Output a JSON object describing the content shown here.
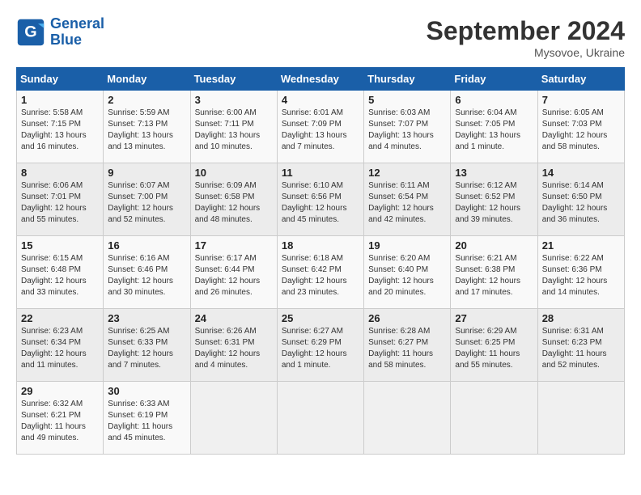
{
  "header": {
    "logo_line1": "General",
    "logo_line2": "Blue",
    "month": "September 2024",
    "location": "Mysovoe, Ukraine"
  },
  "days_of_week": [
    "Sunday",
    "Monday",
    "Tuesday",
    "Wednesday",
    "Thursday",
    "Friday",
    "Saturday"
  ],
  "weeks": [
    [
      {
        "day": "1",
        "sunrise": "Sunrise: 5:58 AM",
        "sunset": "Sunset: 7:15 PM",
        "daylight": "Daylight: 13 hours and 16 minutes."
      },
      {
        "day": "2",
        "sunrise": "Sunrise: 5:59 AM",
        "sunset": "Sunset: 7:13 PM",
        "daylight": "Daylight: 13 hours and 13 minutes."
      },
      {
        "day": "3",
        "sunrise": "Sunrise: 6:00 AM",
        "sunset": "Sunset: 7:11 PM",
        "daylight": "Daylight: 13 hours and 10 minutes."
      },
      {
        "day": "4",
        "sunrise": "Sunrise: 6:01 AM",
        "sunset": "Sunset: 7:09 PM",
        "daylight": "Daylight: 13 hours and 7 minutes."
      },
      {
        "day": "5",
        "sunrise": "Sunrise: 6:03 AM",
        "sunset": "Sunset: 7:07 PM",
        "daylight": "Daylight: 13 hours and 4 minutes."
      },
      {
        "day": "6",
        "sunrise": "Sunrise: 6:04 AM",
        "sunset": "Sunset: 7:05 PM",
        "daylight": "Daylight: 13 hours and 1 minute."
      },
      {
        "day": "7",
        "sunrise": "Sunrise: 6:05 AM",
        "sunset": "Sunset: 7:03 PM",
        "daylight": "Daylight: 12 hours and 58 minutes."
      }
    ],
    [
      {
        "day": "8",
        "sunrise": "Sunrise: 6:06 AM",
        "sunset": "Sunset: 7:01 PM",
        "daylight": "Daylight: 12 hours and 55 minutes."
      },
      {
        "day": "9",
        "sunrise": "Sunrise: 6:07 AM",
        "sunset": "Sunset: 7:00 PM",
        "daylight": "Daylight: 12 hours and 52 minutes."
      },
      {
        "day": "10",
        "sunrise": "Sunrise: 6:09 AM",
        "sunset": "Sunset: 6:58 PM",
        "daylight": "Daylight: 12 hours and 48 minutes."
      },
      {
        "day": "11",
        "sunrise": "Sunrise: 6:10 AM",
        "sunset": "Sunset: 6:56 PM",
        "daylight": "Daylight: 12 hours and 45 minutes."
      },
      {
        "day": "12",
        "sunrise": "Sunrise: 6:11 AM",
        "sunset": "Sunset: 6:54 PM",
        "daylight": "Daylight: 12 hours and 42 minutes."
      },
      {
        "day": "13",
        "sunrise": "Sunrise: 6:12 AM",
        "sunset": "Sunset: 6:52 PM",
        "daylight": "Daylight: 12 hours and 39 minutes."
      },
      {
        "day": "14",
        "sunrise": "Sunrise: 6:14 AM",
        "sunset": "Sunset: 6:50 PM",
        "daylight": "Daylight: 12 hours and 36 minutes."
      }
    ],
    [
      {
        "day": "15",
        "sunrise": "Sunrise: 6:15 AM",
        "sunset": "Sunset: 6:48 PM",
        "daylight": "Daylight: 12 hours and 33 minutes."
      },
      {
        "day": "16",
        "sunrise": "Sunrise: 6:16 AM",
        "sunset": "Sunset: 6:46 PM",
        "daylight": "Daylight: 12 hours and 30 minutes."
      },
      {
        "day": "17",
        "sunrise": "Sunrise: 6:17 AM",
        "sunset": "Sunset: 6:44 PM",
        "daylight": "Daylight: 12 hours and 26 minutes."
      },
      {
        "day": "18",
        "sunrise": "Sunrise: 6:18 AM",
        "sunset": "Sunset: 6:42 PM",
        "daylight": "Daylight: 12 hours and 23 minutes."
      },
      {
        "day": "19",
        "sunrise": "Sunrise: 6:20 AM",
        "sunset": "Sunset: 6:40 PM",
        "daylight": "Daylight: 12 hours and 20 minutes."
      },
      {
        "day": "20",
        "sunrise": "Sunrise: 6:21 AM",
        "sunset": "Sunset: 6:38 PM",
        "daylight": "Daylight: 12 hours and 17 minutes."
      },
      {
        "day": "21",
        "sunrise": "Sunrise: 6:22 AM",
        "sunset": "Sunset: 6:36 PM",
        "daylight": "Daylight: 12 hours and 14 minutes."
      }
    ],
    [
      {
        "day": "22",
        "sunrise": "Sunrise: 6:23 AM",
        "sunset": "Sunset: 6:34 PM",
        "daylight": "Daylight: 12 hours and 11 minutes."
      },
      {
        "day": "23",
        "sunrise": "Sunrise: 6:25 AM",
        "sunset": "Sunset: 6:33 PM",
        "daylight": "Daylight: 12 hours and 7 minutes."
      },
      {
        "day": "24",
        "sunrise": "Sunrise: 6:26 AM",
        "sunset": "Sunset: 6:31 PM",
        "daylight": "Daylight: 12 hours and 4 minutes."
      },
      {
        "day": "25",
        "sunrise": "Sunrise: 6:27 AM",
        "sunset": "Sunset: 6:29 PM",
        "daylight": "Daylight: 12 hours and 1 minute."
      },
      {
        "day": "26",
        "sunrise": "Sunrise: 6:28 AM",
        "sunset": "Sunset: 6:27 PM",
        "daylight": "Daylight: 11 hours and 58 minutes."
      },
      {
        "day": "27",
        "sunrise": "Sunrise: 6:29 AM",
        "sunset": "Sunset: 6:25 PM",
        "daylight": "Daylight: 11 hours and 55 minutes."
      },
      {
        "day": "28",
        "sunrise": "Sunrise: 6:31 AM",
        "sunset": "Sunset: 6:23 PM",
        "daylight": "Daylight: 11 hours and 52 minutes."
      }
    ],
    [
      {
        "day": "29",
        "sunrise": "Sunrise: 6:32 AM",
        "sunset": "Sunset: 6:21 PM",
        "daylight": "Daylight: 11 hours and 49 minutes."
      },
      {
        "day": "30",
        "sunrise": "Sunrise: 6:33 AM",
        "sunset": "Sunset: 6:19 PM",
        "daylight": "Daylight: 11 hours and 45 minutes."
      },
      null,
      null,
      null,
      null,
      null
    ]
  ]
}
